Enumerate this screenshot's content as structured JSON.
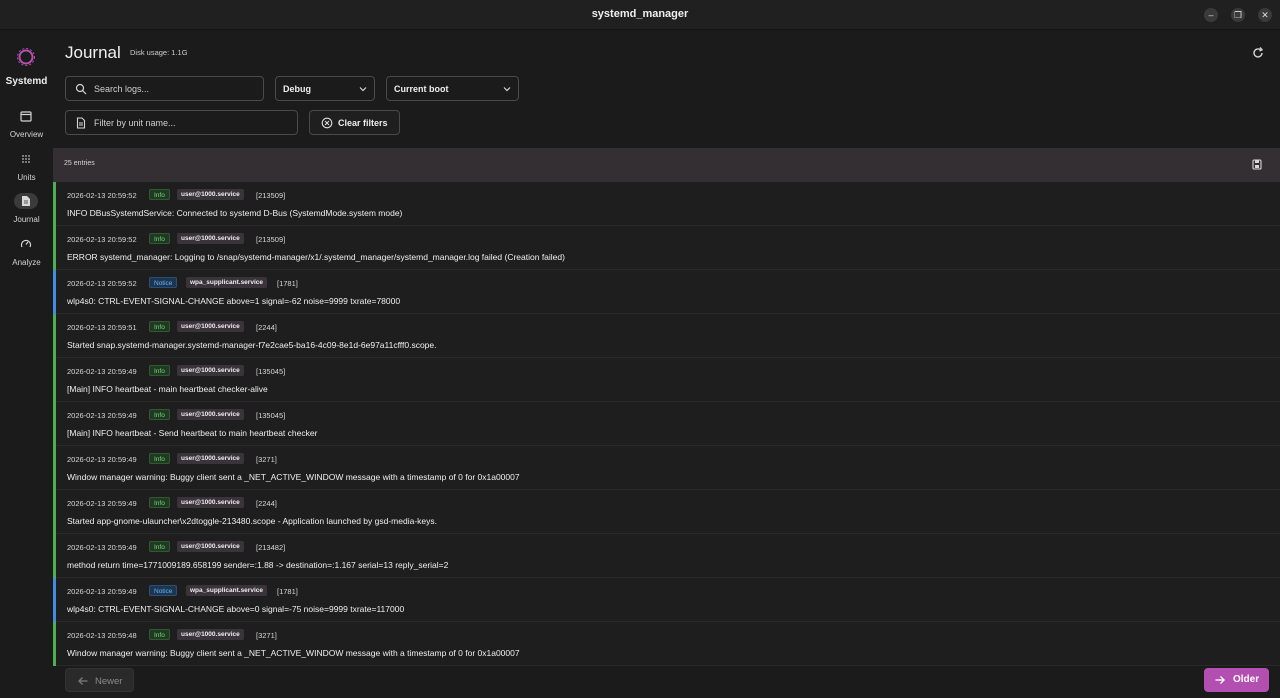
{
  "window": {
    "title": "systemd_manager"
  },
  "sidebar": {
    "brand": "Systemd",
    "items": [
      {
        "label": "Overview",
        "icon": "window-icon",
        "active": false
      },
      {
        "label": "Units",
        "icon": "grid-dots-icon",
        "active": false
      },
      {
        "label": "Journal",
        "icon": "document-icon",
        "active": true
      },
      {
        "label": "Analyze",
        "icon": "gauge-icon",
        "active": false
      }
    ]
  },
  "header": {
    "title": "Journal",
    "disk_usage": "Disk usage: 1.1G"
  },
  "filters": {
    "search_placeholder": "Search logs...",
    "priority_selected": "Debug",
    "boot_selected": "Current boot",
    "unit_placeholder": "Filter by unit name...",
    "clear_label": "Clear filters"
  },
  "list": {
    "count_label": "25 entries"
  },
  "colors": {
    "info_bar": "#4caf50",
    "notice_bar": "#3f8ee0",
    "accent": "#b44fb2"
  },
  "entries": [
    {
      "timestamp": "2026-02-13 20:59:52",
      "level": "Info",
      "unit": "user@1000.service",
      "pid": "[213509]",
      "message": "INFO DBusSystemdService: Connected to systemd D-Bus (SystemdMode.system mode)"
    },
    {
      "timestamp": "2026-02-13 20:59:52",
      "level": "Info",
      "unit": "user@1000.service",
      "pid": "[213509]",
      "message": "ERROR systemd_manager: Logging to /snap/systemd-manager/x1/.systemd_manager/systemd_manager.log failed (Creation failed)"
    },
    {
      "timestamp": "2026-02-13 20:59:52",
      "level": "Notice",
      "unit": "wpa_supplicant.service",
      "pid": "[1781]",
      "message": "wlp4s0: CTRL-EVENT-SIGNAL-CHANGE above=1 signal=-62 noise=9999 txrate=78000"
    },
    {
      "timestamp": "2026-02-13 20:59:51",
      "level": "Info",
      "unit": "user@1000.service",
      "pid": "[2244]",
      "message": "Started snap.systemd-manager.systemd-manager-f7e2cae5-ba16-4c09-8e1d-6e97a11cfff0.scope."
    },
    {
      "timestamp": "2026-02-13 20:59:49",
      "level": "Info",
      "unit": "user@1000.service",
      "pid": "[135045]",
      "message": "[Main] INFO heartbeat - main heartbeat checker-alive"
    },
    {
      "timestamp": "2026-02-13 20:59:49",
      "level": "Info",
      "unit": "user@1000.service",
      "pid": "[135045]",
      "message": "[Main] INFO heartbeat - Send heartbeat to main heartbeat checker"
    },
    {
      "timestamp": "2026-02-13 20:59:49",
      "level": "Info",
      "unit": "user@1000.service",
      "pid": "[3271]",
      "message": "Window manager warning: Buggy client sent a _NET_ACTIVE_WINDOW message with a timestamp of 0 for 0x1a00007"
    },
    {
      "timestamp": "2026-02-13 20:59:49",
      "level": "Info",
      "unit": "user@1000.service",
      "pid": "[2244]",
      "message": "Started app-gnome-ulauncher\\x2dtoggle-213480.scope - Application launched by gsd-media-keys."
    },
    {
      "timestamp": "2026-02-13 20:59:49",
      "level": "Info",
      "unit": "user@1000.service",
      "pid": "[213482]",
      "message": "method return time=1771009189.658199 sender=:1.88 -> destination=:1.167 serial=13 reply_serial=2"
    },
    {
      "timestamp": "2026-02-13 20:59:49",
      "level": "Notice",
      "unit": "wpa_supplicant.service",
      "pid": "[1781]",
      "message": "wlp4s0: CTRL-EVENT-SIGNAL-CHANGE above=0 signal=-75 noise=9999 txrate=117000"
    },
    {
      "timestamp": "2026-02-13 20:59:48",
      "level": "Info",
      "unit": "user@1000.service",
      "pid": "[3271]",
      "message": "Window manager warning: Buggy client sent a _NET_ACTIVE_WINDOW message with a timestamp of 0 for 0x1a00007"
    }
  ],
  "pager": {
    "newer_label": "Newer",
    "older_label": "Older"
  }
}
